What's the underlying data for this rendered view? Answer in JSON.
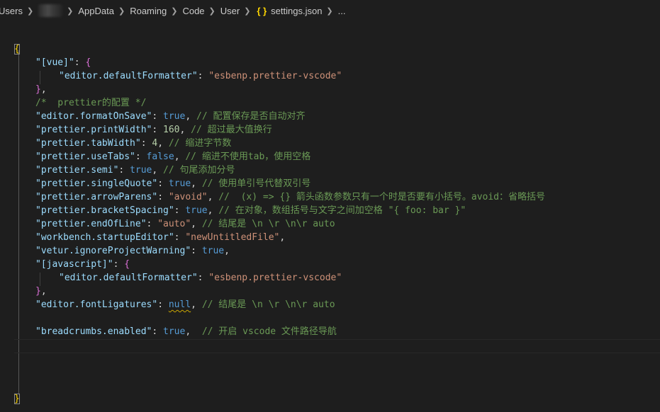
{
  "breadcrumb": {
    "users": "Users",
    "user_redacted": "",
    "appdata": "AppData",
    "roaming": "Roaming",
    "code": "Code",
    "user": "User",
    "json_icon": "{ }",
    "file": "settings.json",
    "more": "..."
  },
  "editor": {
    "open_brace": "{",
    "close_brace": "}",
    "vue_key": "\"[vue]\"",
    "vue_formatter_key": "\"editor.defaultFormatter\"",
    "vue_formatter_val": "\"esbenp.prettier-vscode\"",
    "prettier_comment": "/*  prettier的配置 */",
    "formatOnSave_key": "\"editor.formatOnSave\"",
    "formatOnSave_val": "true",
    "formatOnSave_comment": "// 配置保存是否自动对齐",
    "printWidth_key": "\"prettier.printWidth\"",
    "printWidth_val": "160",
    "printWidth_comment": "// 超过最大值换行",
    "tabWidth_key": "\"prettier.tabWidth\"",
    "tabWidth_val": "4",
    "tabWidth_comment": "// 缩进字节数",
    "useTabs_key": "\"prettier.useTabs\"",
    "useTabs_val": "false",
    "useTabs_comment": "// 缩进不使用tab，使用空格",
    "semi_key": "\"prettier.semi\"",
    "semi_val": "true",
    "semi_comment": "// 句尾添加分号",
    "singleQuote_key": "\"prettier.singleQuote\"",
    "singleQuote_val": "true",
    "singleQuote_comment": "// 使用单引号代替双引号",
    "arrowParens_key": "\"prettier.arrowParens\"",
    "arrowParens_val": "\"avoid\"",
    "arrowParens_comment": "//  (x) => {} 箭头函数参数只有一个时是否要有小括号。avoid：省略括号",
    "bracketSpacing_key": "\"prettier.bracketSpacing\"",
    "bracketSpacing_val": "true",
    "bracketSpacing_comment": "// 在对象，数组括号与文字之间加空格 \"{ foo: bar }\"",
    "endOfLine_key": "\"prettier.endOfLine\"",
    "endOfLine_val": "\"auto\"",
    "endOfLine_comment": "// 结尾是 \\n \\r \\n\\r auto",
    "startupEditor_key": "\"workbench.startupEditor\"",
    "startupEditor_val": "\"newUntitledFile\"",
    "ignoreProjectWarning_key": "\"vetur.ignoreProjectWarning\"",
    "ignoreProjectWarning_val": "true",
    "js_key": "\"[javascript]\"",
    "js_formatter_key": "\"editor.defaultFormatter\"",
    "js_formatter_val": "\"esbenp.prettier-vscode\"",
    "fontLigatures_key": "\"editor.fontLigatures\"",
    "fontLigatures_val": "null",
    "fontLigatures_comment": "// 结尾是 \\n \\r \\n\\r auto",
    "breadcrumbs_key": "\"breadcrumbs.enabled\"",
    "breadcrumbs_val": "true",
    "breadcrumbs_comment": "// 开启 vscode 文件路径导航"
  },
  "colors": {
    "background": "#1e1e1e",
    "key": "#9cdcfe",
    "string": "#ce9178",
    "keyword": "#569cd6",
    "number": "#b5cea8",
    "comment": "#6a9955",
    "bracket_level1": "#ffd700",
    "bracket_level2": "#da70d6"
  }
}
